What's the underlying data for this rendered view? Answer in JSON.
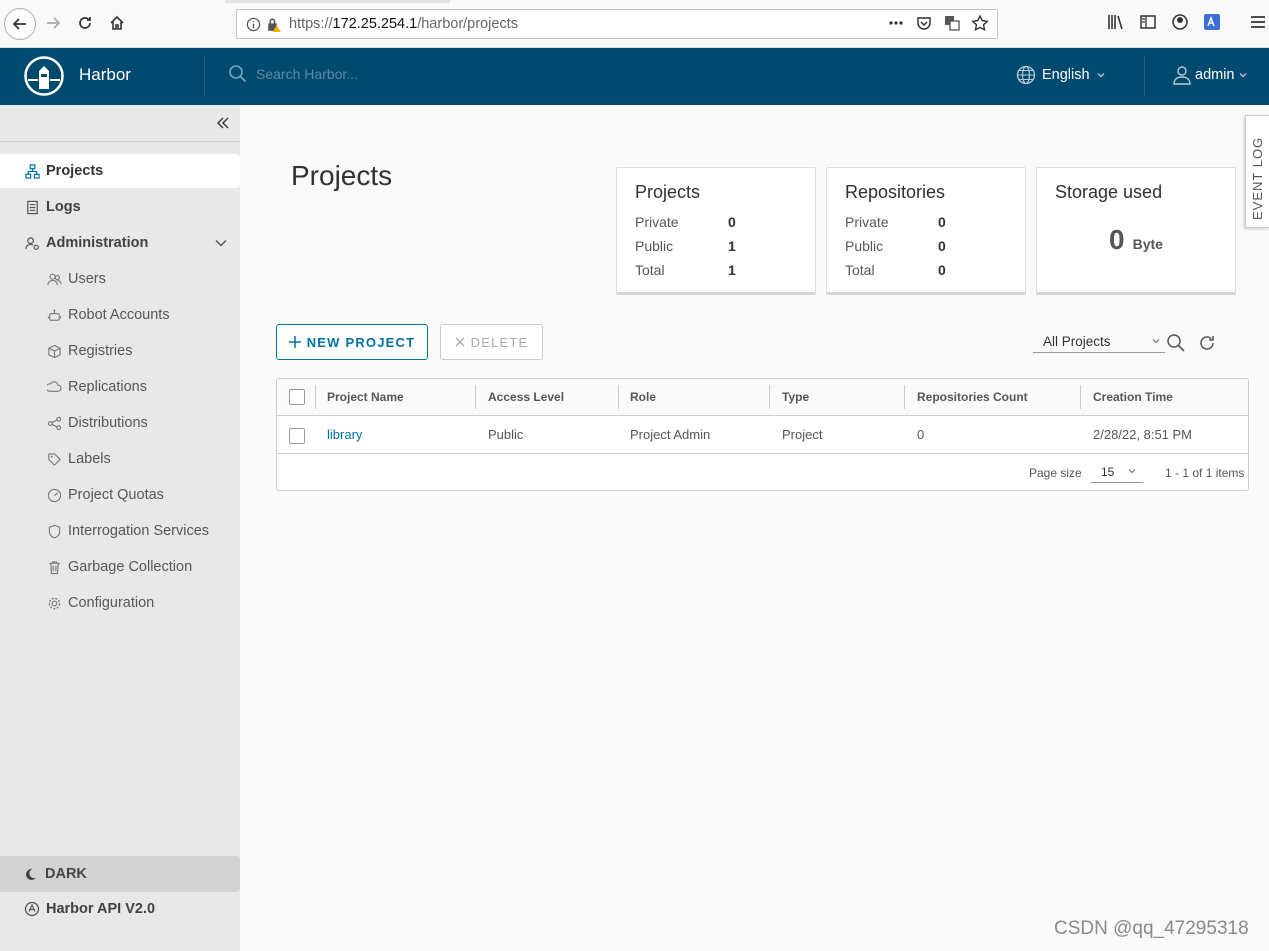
{
  "browser": {
    "url_prefix": "https://",
    "url_host": "172.25.254.1",
    "url_path": "/harbor/projects"
  },
  "header": {
    "brand": "Harbor",
    "search_placeholder": "Search Harbor...",
    "language": "English",
    "user": "admin"
  },
  "sidebar": {
    "items": [
      {
        "label": "Projects",
        "icon": "projects-icon"
      },
      {
        "label": "Logs",
        "icon": "logs-icon"
      },
      {
        "label": "Administration",
        "icon": "administration-icon"
      }
    ],
    "admin_items": [
      {
        "label": "Users"
      },
      {
        "label": "Robot Accounts"
      },
      {
        "label": "Registries"
      },
      {
        "label": "Replications"
      },
      {
        "label": "Distributions"
      },
      {
        "label": "Labels"
      },
      {
        "label": "Project Quotas"
      },
      {
        "label": "Interrogation Services"
      },
      {
        "label": "Garbage Collection"
      },
      {
        "label": "Configuration"
      }
    ],
    "dark_label": "DARK",
    "api_label": "Harbor API V2.0"
  },
  "main": {
    "title": "Projects",
    "cards": {
      "projects": {
        "title": "Projects",
        "private_label": "Private",
        "private": "0",
        "public_label": "Public",
        "public": "1",
        "total_label": "Total",
        "total": "1"
      },
      "repositories": {
        "title": "Repositories",
        "private_label": "Private",
        "private": "0",
        "public_label": "Public",
        "public": "0",
        "total_label": "Total",
        "total": "0"
      },
      "storage": {
        "title": "Storage used",
        "value": "0",
        "unit": "Byte"
      }
    },
    "event_log": "EVENT LOG",
    "new_project_label": "NEW PROJECT",
    "delete_label": "DELETE",
    "filter_selected": "All Projects",
    "table": {
      "columns": [
        "Project Name",
        "Access Level",
        "Role",
        "Type",
        "Repositories Count",
        "Creation Time"
      ],
      "rows": [
        {
          "name": "library",
          "access": "Public",
          "role": "Project Admin",
          "type": "Project",
          "repo_count": "0",
          "created": "2/28/22, 8:51 PM"
        }
      ],
      "page_size_label": "Page size",
      "page_size": "15",
      "range": "1 - 1 of 1 items"
    }
  },
  "watermark": "CSDN @qq_47295318",
  "colors": {
    "header_bg": "#004a70",
    "link": "#0072a3",
    "sidebar_bg": "#e8e8e8"
  }
}
